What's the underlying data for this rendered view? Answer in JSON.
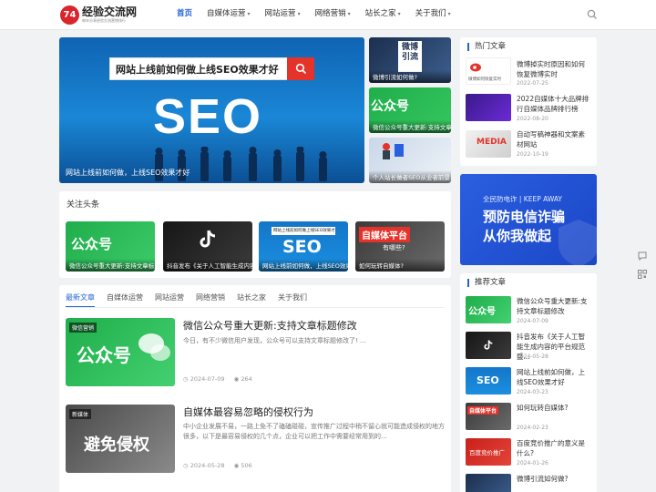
{
  "logo": {
    "mark": "74",
    "title": "经验交流网",
    "subtitle": "每年分享经验交流营销排行"
  },
  "nav": [
    {
      "label": "首页",
      "active": true,
      "caret": false
    },
    {
      "label": "自媒体运营",
      "caret": true
    },
    {
      "label": "网站运营",
      "caret": true
    },
    {
      "label": "网络营销",
      "caret": true
    },
    {
      "label": "站长之家",
      "caret": true
    },
    {
      "label": "关于我们",
      "caret": true
    }
  ],
  "slider": {
    "banner_text": "网站上线前如何做上线SEO效果才好",
    "big_text": "SEO",
    "caption": "网站上线前如何做，上线SEO效果才好"
  },
  "slider_thumbs": [
    {
      "caption": "微博引流如何做?",
      "img_text": "微博引流"
    },
    {
      "caption": "微信公众号重大更新:支持文章标题修改",
      "img_text": "公众号"
    },
    {
      "caption": "个人站长做者SEO从业者前景",
      "img_text": ""
    }
  ],
  "headlines": {
    "title": "关注头条",
    "items": [
      {
        "caption": "微信公众号重大更新:支持文章标题修改",
        "img_text": "公众号"
      },
      {
        "caption": "抖音发布《关于人工智能生成内容的平台规范暨行业倡议》",
        "img_text": ""
      },
      {
        "caption": "网站上线前如何做，上线SEO效果才好",
        "img_text": "SEO",
        "banner": "网站上线前如何做上线SEO效果才好"
      },
      {
        "caption": "如何玩转自媒体?",
        "img_text": "自媒体平台",
        "sub": "有哪些?"
      }
    ]
  },
  "article_tabs": [
    "最新文章",
    "自媒体运营",
    "网站运营",
    "网络营销",
    "站长之家",
    "关于我们"
  ],
  "posts": [
    {
      "tag": "微信营销",
      "img_text": "公众号",
      "title": "微信公众号重大更新:支持文章标题修改",
      "summary": "今日，有不少微信用户发现，公众号可以支持文章标题修改了! ...",
      "date": "2024-07-09",
      "views": "264"
    },
    {
      "tag": "新媒体",
      "img_text": "避免侵权",
      "title": "自媒体最容易忽略的侵权行为",
      "summary": "中小企业发展不易，一路上免不了磕磕碰碰，宣传推广过程中稍不留心就可能造成侵权的地方很多，以下是最容易侵权的几个点，企业可以把工作中需要经常用到的...",
      "date": "2024-05-28",
      "views": "506"
    }
  ],
  "hot": {
    "title": "热门文章",
    "items": [
      {
        "text": "微博掉实时原因和如何恢复微博实时",
        "date": "2022-07-25",
        "img_text": "微博如何恢复实时"
      },
      {
        "text": "2022自媒体十大品牌排行自媒体品牌排行榜",
        "date": "2022-08-20",
        "img_text": ""
      },
      {
        "text": "自动写稿神器和文案素材网站",
        "date": "2022-10-19",
        "img_text": "MEDIA"
      }
    ]
  },
  "ad": {
    "small": "全民防电诈 | KEEP AWAY",
    "line1": "预防电信诈骗",
    "line2": "从你我做起"
  },
  "recommend": {
    "title": "推荐文章",
    "items": [
      {
        "text": "微信公众号重大更新:支持文章标题修改",
        "date": "2024-07-09",
        "img_text": "公众号"
      },
      {
        "text": "抖音发布《关于人工智能生成内容的平台规范暨...",
        "date": "2024-05-28",
        "img_text": ""
      },
      {
        "text": "网站上线前如何做，上线SEO效果才好",
        "date": "2024-03-23",
        "img_text": "SEO"
      },
      {
        "text": "如何玩转自媒体?",
        "date": "2024-02-23",
        "img_text": "自媒体平台"
      },
      {
        "text": "百度竞价推广的意义是什么?",
        "date": "2024-01-26",
        "img_text": "百度竞价推广"
      },
      {
        "text": "微博引流如何做?",
        "date": "",
        "img_text": ""
      }
    ]
  },
  "colors": {
    "accent": "#2163d6",
    "wechat_green": "#1fae4b",
    "ad_blue": "#2a5fe0"
  }
}
